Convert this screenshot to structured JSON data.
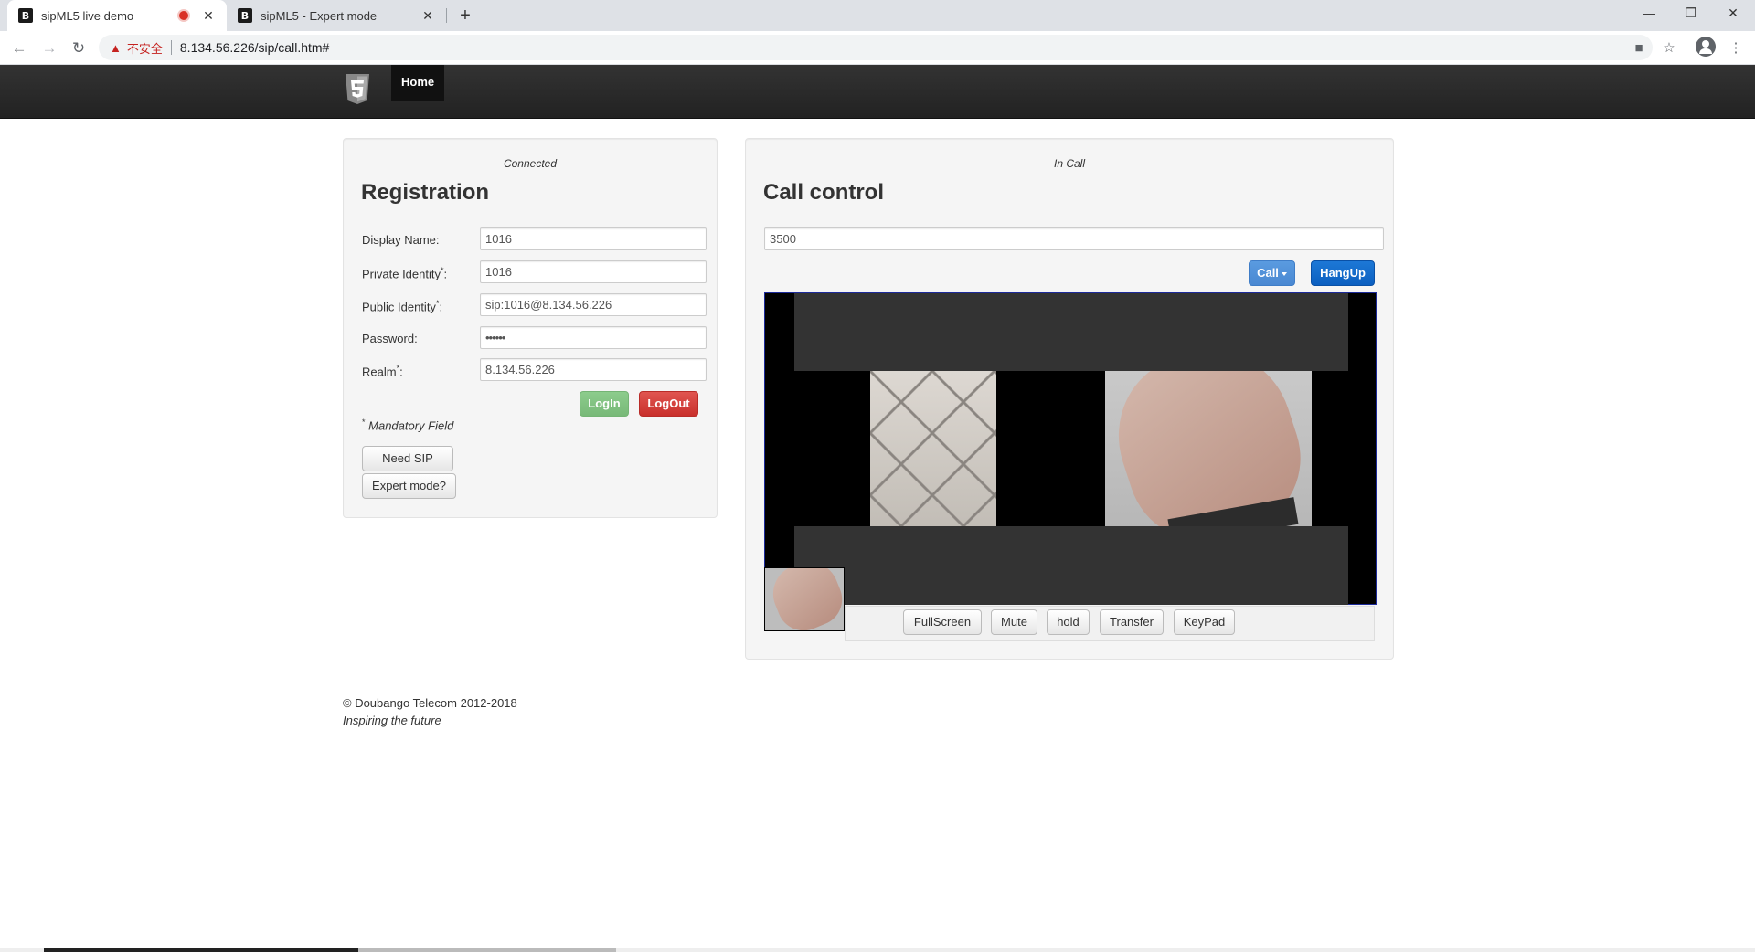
{
  "browser": {
    "tabs": [
      {
        "title": "sipML5 live demo",
        "favicon": "B",
        "recording": true
      },
      {
        "title": "sipML5 - Expert mode",
        "favicon": "B",
        "recording": false
      }
    ],
    "insecure_label": "不安全",
    "url": "8.134.56.226/sip/call.htm#"
  },
  "navbar": {
    "logo": "html5-logo-icon",
    "home_label": "Home"
  },
  "registration": {
    "status": "Connected",
    "title": "Registration",
    "fields": {
      "display_name": {
        "label": "Display Name:",
        "value": "1016"
      },
      "private_identity": {
        "label": "Private Identity",
        "value": "1016"
      },
      "public_identity": {
        "label": "Public Identity",
        "value": "sip:1016@8.134.56.226"
      },
      "password": {
        "label": "Password:",
        "value": "••••••"
      },
      "realm": {
        "label": "Realm",
        "value": "8.134.56.226"
      }
    },
    "required_mark": "*",
    "colon": ":",
    "login_label": "LogIn",
    "logout_label": "LogOut",
    "mandatory_note": "Mandatory Field",
    "need_account_label": "Need SIP account?",
    "expert_mode_label": "Expert mode?"
  },
  "call_control": {
    "status": "In Call",
    "title": "Call control",
    "dial_value": "3500",
    "call_label": "Call",
    "hangup_label": "HangUp",
    "controls": [
      "FullScreen",
      "Mute",
      "hold",
      "Transfer",
      "KeyPad"
    ]
  },
  "footer": {
    "copyright": "© Doubango Telecom 2012-2018",
    "tagline": "Inspiring the future"
  },
  "colors": {
    "navbar": "#222222",
    "login_btn": "#7cbc7c",
    "logout_btn": "#d9534f",
    "call_btn": "#4a88d2",
    "hangup_btn": "#0b5fc0"
  }
}
